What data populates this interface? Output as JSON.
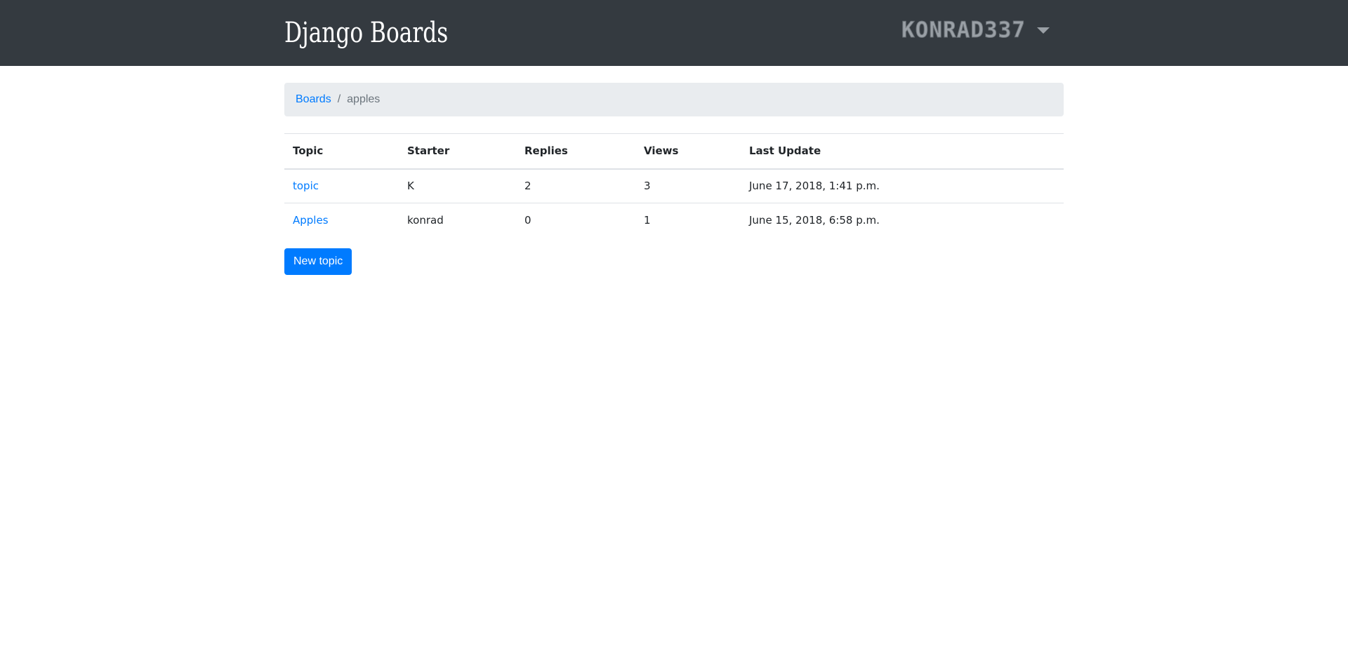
{
  "navbar": {
    "brand": "Django Boards",
    "username": "KONRAD337"
  },
  "breadcrumb": {
    "boards_link": "Boards",
    "separator": "/",
    "current": "apples"
  },
  "table": {
    "headers": {
      "topic": "Topic",
      "starter": "Starter",
      "replies": "Replies",
      "views": "Views",
      "last_update": "Last Update"
    },
    "rows": [
      {
        "topic": "topic",
        "starter": "K",
        "replies": "2",
        "views": "3",
        "last_update": "June 17, 2018, 1:41 p.m."
      },
      {
        "topic": "Apples",
        "starter": "konrad",
        "replies": "0",
        "views": "1",
        "last_update": "June 15, 2018, 6:58 p.m."
      }
    ]
  },
  "actions": {
    "new_topic_label": "New topic"
  },
  "colors": {
    "navbar_bg": "#343a40",
    "link": "#007bff",
    "primary_button": "#007bff",
    "breadcrumb_bg": "#e9ecef"
  },
  "icons": {
    "user_menu_toggle": "caret-down-icon"
  }
}
